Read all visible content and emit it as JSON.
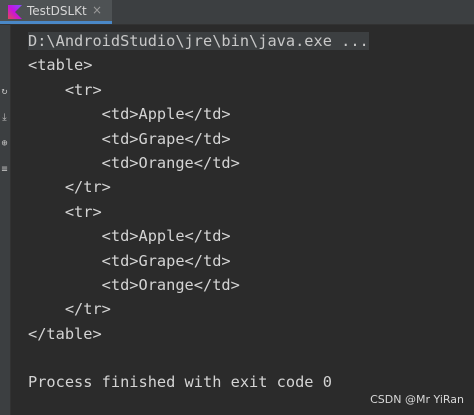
{
  "tab": {
    "title": "TestDSLKt",
    "close_glyph": "×",
    "icon": "kotlin-file-icon",
    "accent": "#4a88c7"
  },
  "gutter": {
    "icons": [
      "rerun-icon",
      "scroll-to-end-icon",
      "pin-tab-icon",
      "soft-wrap-icon"
    ]
  },
  "console": {
    "command": "D:\\AndroidStudio\\jre\\bin\\java.exe ...",
    "output_lines": [
      "<table>",
      "    <tr>",
      "        <td>Apple</td>",
      "        <td>Grape</td>",
      "        <td>Orange</td>",
      "    </tr>",
      "    <tr>",
      "        <td>Apple</td>",
      "        <td>Grape</td>",
      "        <td>Orange</td>",
      "    </tr>",
      "</table>",
      "",
      "Process finished with exit code 0"
    ]
  },
  "watermark": "CSDN @Mr YiRan",
  "colors": {
    "background": "#2b2b2b",
    "text": "#d4d4d4",
    "tab_active": "#4e5254"
  }
}
